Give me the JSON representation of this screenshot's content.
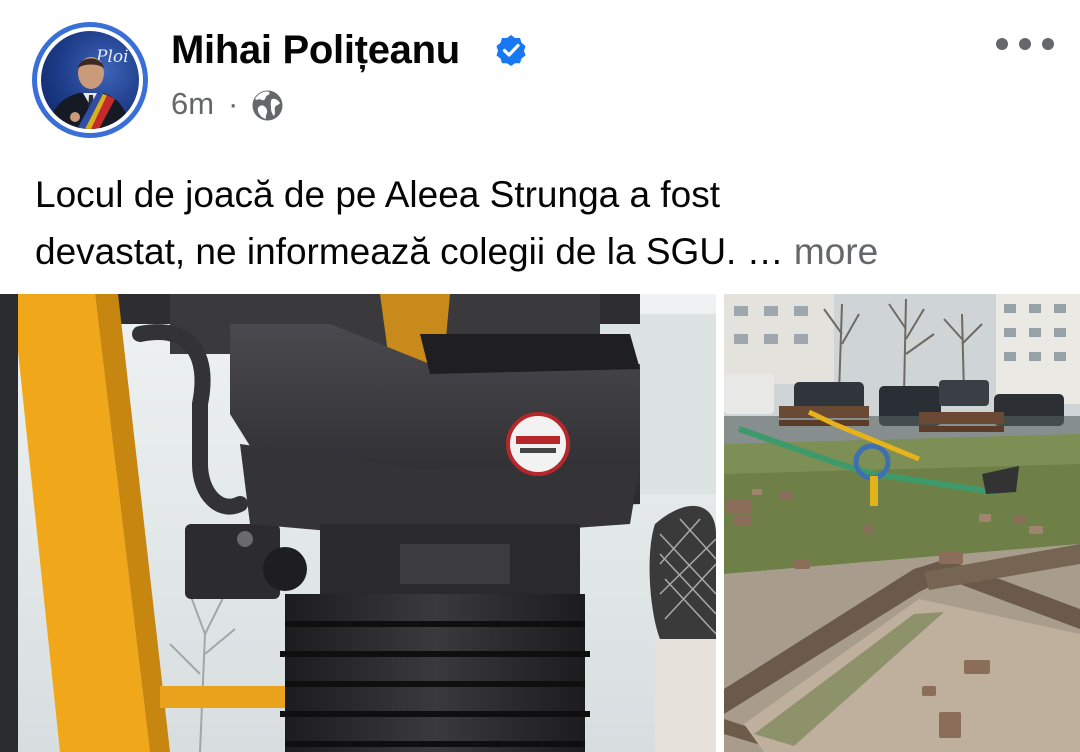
{
  "author": {
    "name": "Mihai Polițeanu",
    "verified": true,
    "avatar_brand_text": "Ploi"
  },
  "meta": {
    "time": "6m",
    "separator": "·",
    "audience_icon": "globe-icon"
  },
  "post": {
    "text_line_1": "Locul de joacă de pe Aleea Strunga a fost",
    "text_line_2": "devastat, ne informează colegii de la SGU. … ",
    "see_more_label": "more"
  },
  "icons": {
    "verified": "verified-badge-icon",
    "more": "more-options-icon",
    "globe": "globe-icon"
  },
  "colors": {
    "name_text": "#050505",
    "secondary_text": "#65676b",
    "verified_blue": "#1877f2",
    "avatar_ring": "#3b6fd8"
  },
  "photos": [
    {
      "name": "photo-excavator-seat"
    },
    {
      "name": "photo-playground"
    }
  ]
}
